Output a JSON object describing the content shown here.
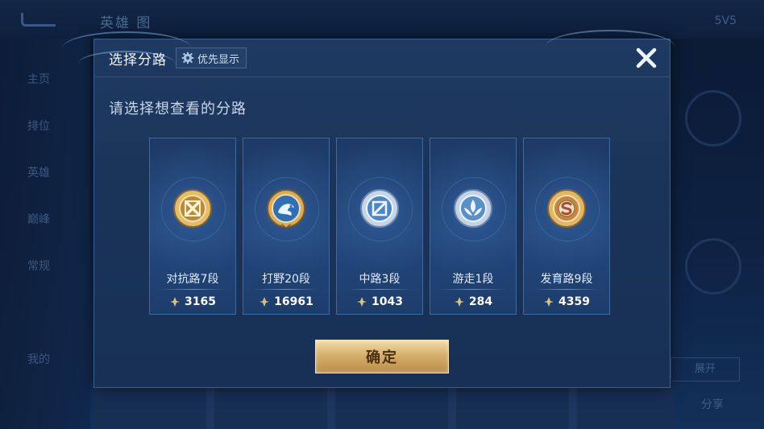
{
  "background": {
    "title": "英雄 图",
    "right_text": "5V5",
    "sidebar_items": [
      "主页",
      "排位",
      "英雄",
      "巅峰",
      "常规",
      "我的"
    ],
    "right_button": "展开",
    "bottom_right": "分享"
  },
  "dialog": {
    "title": "选择分路",
    "priority_button": "优先显示",
    "prompt": "请选择想查看的分路",
    "confirm": "确定",
    "lanes": [
      {
        "label": "对抗路7段",
        "score": "3165",
        "icon": "clash-lane-badge-icon",
        "theme": "gold"
      },
      {
        "label": "打野20段",
        "score": "16961",
        "icon": "jungle-dragon-badge-icon",
        "theme": "gold-blue"
      },
      {
        "label": "中路3段",
        "score": "1043",
        "icon": "mid-lane-badge-icon",
        "theme": "silver"
      },
      {
        "label": "游走1段",
        "score": "284",
        "icon": "roam-badge-icon",
        "theme": "silver"
      },
      {
        "label": "发育路9段",
        "score": "4359",
        "icon": "farm-lane-badge-icon",
        "theme": "gold"
      }
    ]
  },
  "colors": {
    "gold": "#d9b065",
    "silver": "#b8c9de",
    "accent_blue": "#3f6aa0",
    "confirm_gold": "#d6b06c"
  }
}
